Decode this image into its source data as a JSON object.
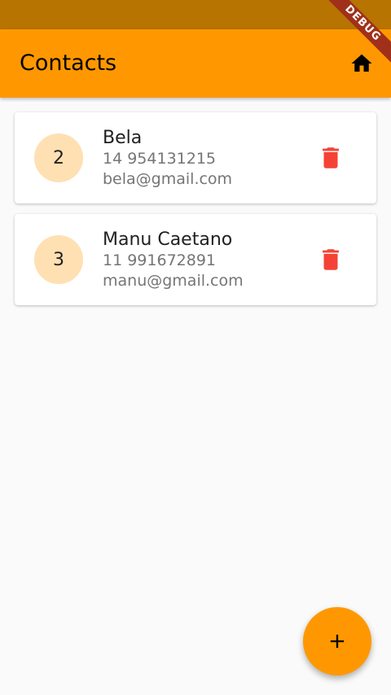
{
  "app_bar": {
    "title": "Contacts",
    "action_icon": "home-icon",
    "background": "#ff9800"
  },
  "debug_banner": "DEBUG",
  "contacts": [
    {
      "avatar_text": "2",
      "name": "Bela",
      "phone": "14 954131215",
      "email": "bela@gmail.com",
      "action_icon": "delete-icon"
    },
    {
      "avatar_text": "3",
      "name": "Manu Caetano",
      "phone": "11 991672891",
      "email": "manu@gmail.com",
      "action_icon": "delete-icon"
    }
  ],
  "fab": {
    "icon": "add-icon",
    "color": "#ff9800"
  },
  "colors": {
    "delete": "#f44336",
    "avatar_bg": "#ffe0b2"
  }
}
